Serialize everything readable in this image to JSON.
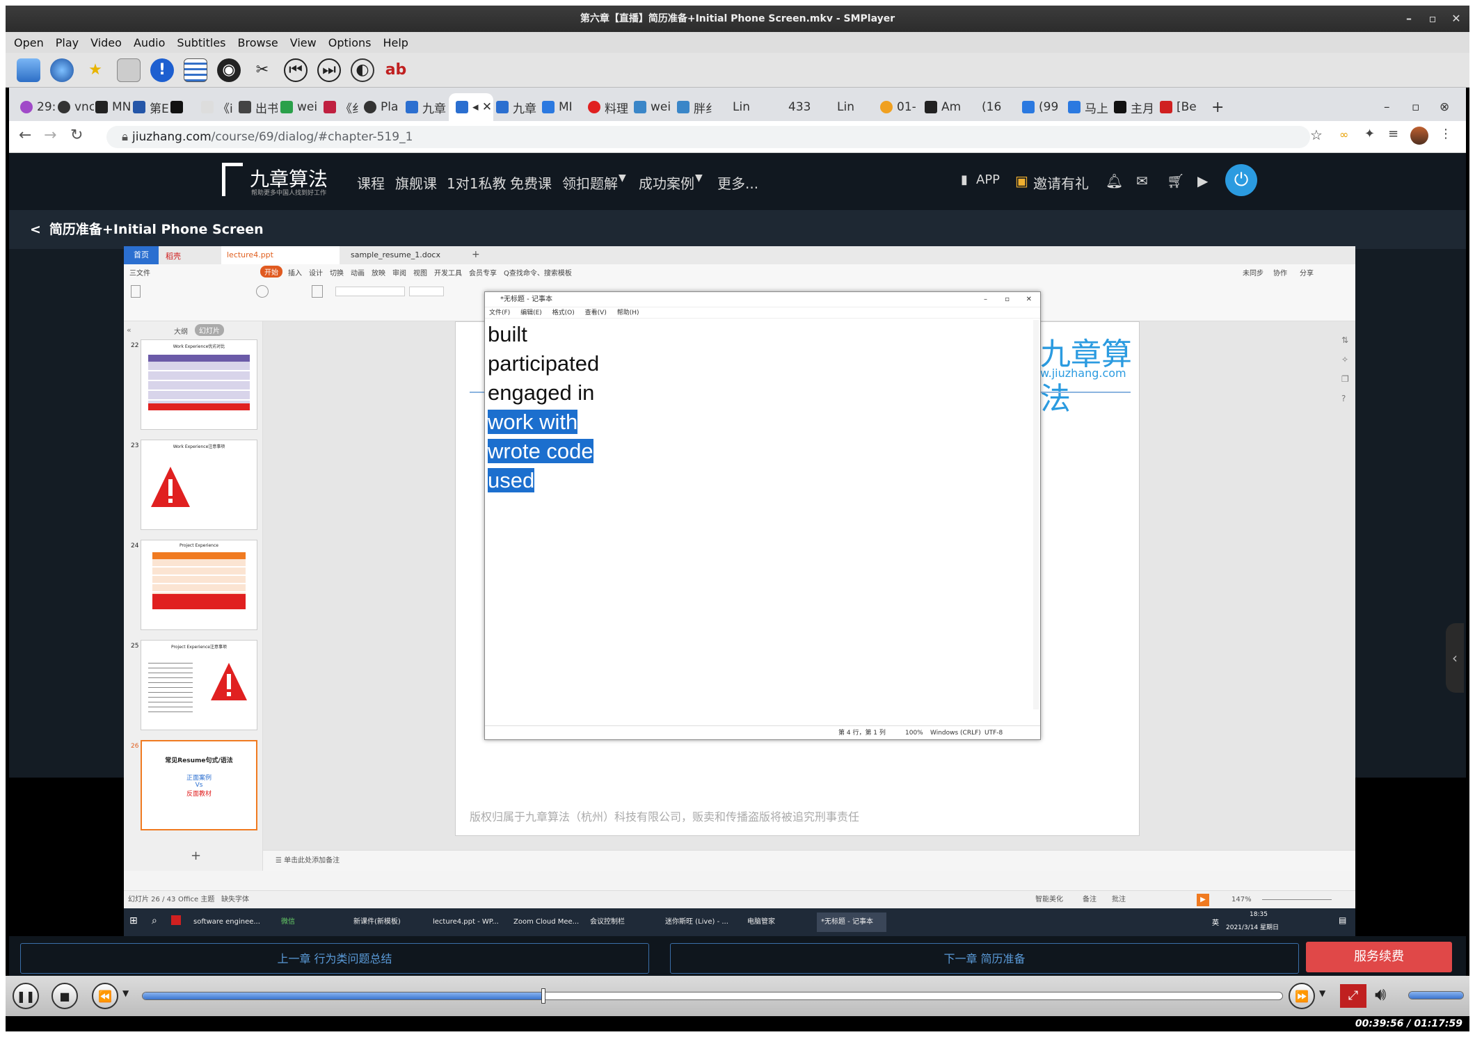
{
  "window": {
    "title": "第六章【直播】简历准备+Initial Phone Screen.mkv - SMPlayer"
  },
  "menubar": [
    "Open",
    "Play",
    "Video",
    "Audio",
    "Subtitles",
    "Browse",
    "View",
    "Options",
    "Help"
  ],
  "toolbar_icons": [
    "open-file-icon",
    "globe-icon",
    "star-icon",
    "screenshot-icon",
    "info-icon",
    "playlist-icon",
    "preferences-icon",
    "tools-icon",
    "previous-icon",
    "next-icon",
    "subtitles-icon",
    "audio-icon"
  ],
  "browser": {
    "tabs": [
      "29:",
      "vnc",
      "MN",
      "第E",
      "《i",
      "出书",
      "wei",
      "《纟",
      "Pla",
      "九章",
      "",
      "九章",
      "MI",
      "料理",
      "wei",
      "胖纟",
      "Lin",
      "433",
      "Lin",
      "01-",
      "Am",
      "(16",
      "(99",
      "马上",
      "主月",
      "[Be"
    ],
    "url": "jiuzhang.com/course/69/dialog/#chapter-519_1",
    "url_host": "jiuzhang.com",
    "url_path": "/course/69/dialog/#chapter-519_1"
  },
  "site": {
    "logo": "九章算法",
    "logo_sub": "帮助更多中国人找到好工作",
    "nav": [
      "课程",
      "旗舰课",
      "1对1私教",
      "免费课",
      "领扣题解",
      "成功案例",
      "更多..."
    ],
    "app_label": "APP",
    "invite_label": "邀请有礼",
    "chapter_title": "简历准备+Initial Phone Screen"
  },
  "wps": {
    "tabs": [
      "首页",
      "稻壳",
      "lecture4.ppt",
      "sample_resume_1.docx"
    ],
    "menu": [
      "三文件",
      "开始",
      "插入",
      "设计",
      "切换",
      "动画",
      "放映",
      "审阅",
      "视图",
      "开发工具",
      "会员专享",
      "Q查找命令、搜索模板"
    ],
    "menu_right": [
      "未同步",
      "协作",
      "分享"
    ],
    "pane_tabs": [
      "大纲",
      "幻灯片"
    ],
    "thumbs": [
      {
        "num": "22",
        "title": "Work Experience优劣对比"
      },
      {
        "num": "23",
        "title": "Work Experience注意事项"
      },
      {
        "num": "24",
        "title": "Project Experience"
      },
      {
        "num": "25",
        "title": "Project Experience注意事项"
      },
      {
        "num": "26",
        "title": "常见Resume句式/语法",
        "lines": [
          "正面案例",
          "Vs",
          "反面教材"
        ]
      }
    ],
    "slide_logo": "九章算法",
    "slide_url": "w.jiuzhang.com",
    "slide_footer": "版权归属于九章算法（杭州）科技有限公司，贩卖和传播盗版将被追究刑事责任",
    "notes_placeholder": "单击此处添加备注",
    "status_left": "幻灯片 26 / 43",
    "status_theme": "Office 主题",
    "status_font": "缺失字体",
    "status_right": [
      "智能美化",
      "备注",
      "批注"
    ],
    "zoom": "147%"
  },
  "notepad": {
    "title": "*无标题 - 记事本",
    "menu": [
      "文件(F)",
      "编辑(E)",
      "格式(O)",
      "查看(V)",
      "帮助(H)"
    ],
    "lines": [
      {
        "text": "built",
        "selected": false
      },
      {
        "text": "participated",
        "selected": false
      },
      {
        "text": "engaged in",
        "selected": false
      },
      {
        "text": "work with",
        "selected": true
      },
      {
        "text": "wrote code",
        "selected": true
      },
      {
        "text": "used",
        "selected": true
      }
    ],
    "status_pos": "第 4 行，第 1 列",
    "status_zoom": "100%",
    "status_eol": "Windows (CRLF)",
    "status_enc": "UTF-8"
  },
  "taskbar": {
    "items": [
      "software enginee...",
      "微信",
      "新课件(新模板)",
      "lecture4.ppt - WP...",
      "Zoom Cloud Mee...",
      "会议控制栏",
      "迷你斯旺 (Live) - ...",
      "电脑管家",
      "*无标题 - 记事本"
    ],
    "time": "18:35",
    "date": "2021/3/14 星期日",
    "ime": "英"
  },
  "chapter_nav": {
    "prev": "上一章 行为类问题总结",
    "next": "下一章 简历准备",
    "pay": "服务续费"
  },
  "player": {
    "progress": 0.352,
    "volume": 1.0,
    "time": "00:39:56 / 01:17:59"
  },
  "colors": {
    "selection": "#1c6fce",
    "site_bg": "#111820",
    "pay_button": "#e04848",
    "seek_fill": "#3b75cf",
    "accent_blue": "#2b9be0"
  }
}
